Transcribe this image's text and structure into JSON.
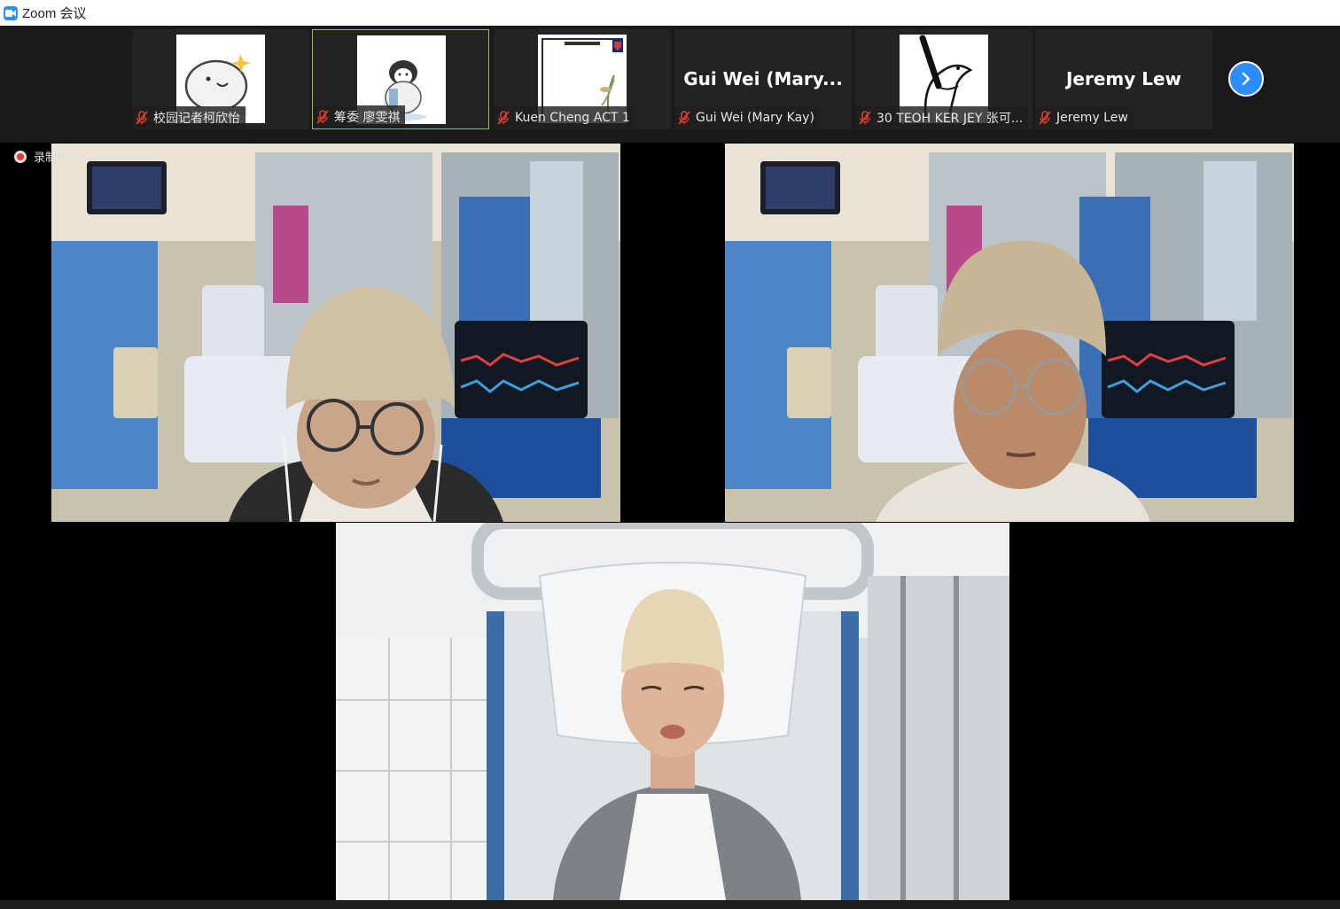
{
  "window": {
    "title": "Zoom 会议",
    "icon": "zoom-camera-icon"
  },
  "participants": [
    {
      "name": "校园记者柯欣怡",
      "muted": true,
      "avatar": "whale-sticker"
    },
    {
      "name": "筹委 廖雯祺",
      "muted": true,
      "avatar": "penguin-sticker",
      "active": true
    },
    {
      "name": "Kuen Cheng ACT 1",
      "muted": true,
      "avatar": "school-logo-card"
    },
    {
      "name": "Gui Wei (Mary Kay)",
      "display_name": "Gui Wei (Mary...",
      "muted": true
    },
    {
      "name": "30 TEOH KER JEY 张可...",
      "muted": true,
      "avatar": "bird-sketch"
    },
    {
      "name": "Jeremy Lew",
      "display_name": "Jeremy Lew",
      "muted": true
    }
  ],
  "recording": {
    "label": "录制中"
  },
  "video_tiles": [
    {
      "scene": "hospital-room",
      "person": "beanie-glasses-earphones"
    },
    {
      "scene": "hospital-room",
      "person": "beanie-glasses"
    },
    {
      "scene": "hospital-bed",
      "person": "beanie-grey-hoodie"
    }
  ],
  "colors": {
    "accent": "#2D8CFF",
    "active_border": "#8fc24a",
    "mute_red": "#e03a2e"
  }
}
